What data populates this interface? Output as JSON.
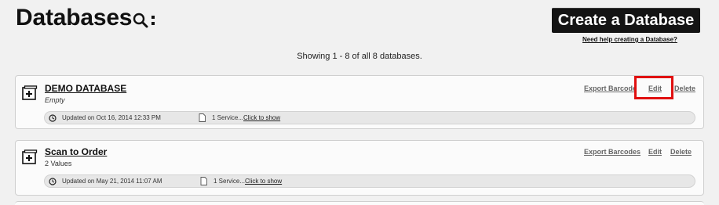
{
  "header": {
    "title": "Databases",
    "create_button": "Create a Database",
    "help_link": "Need help creating a Database?"
  },
  "summary": "Showing 1 - 8 of all 8 databases.",
  "databases": [
    {
      "name": "DEMO DATABASE",
      "subtitle": "Empty",
      "updated": "Updated on Oct 16, 2014 12:33 PM",
      "services": "1 Service...",
      "show_link": "Click to show",
      "export_label": "Export Barcode",
      "edit_label": "Edit",
      "delete_label": "Delete"
    },
    {
      "name": "Scan to Order",
      "subtitle": "2 Values",
      "updated": "Updated on May 21, 2014 11:07 AM",
      "services": "1 Service...",
      "show_link": "Click to show",
      "export_label": "Export Barcodes",
      "edit_label": "Edit",
      "delete_label": "Delete"
    }
  ],
  "colors": {
    "highlight": "#e01010",
    "button_bg": "#141414"
  },
  "icons": {
    "title": "search-options-icon",
    "card": "database-plus-icon",
    "updated": "clock-icon",
    "services": "document-icon"
  }
}
